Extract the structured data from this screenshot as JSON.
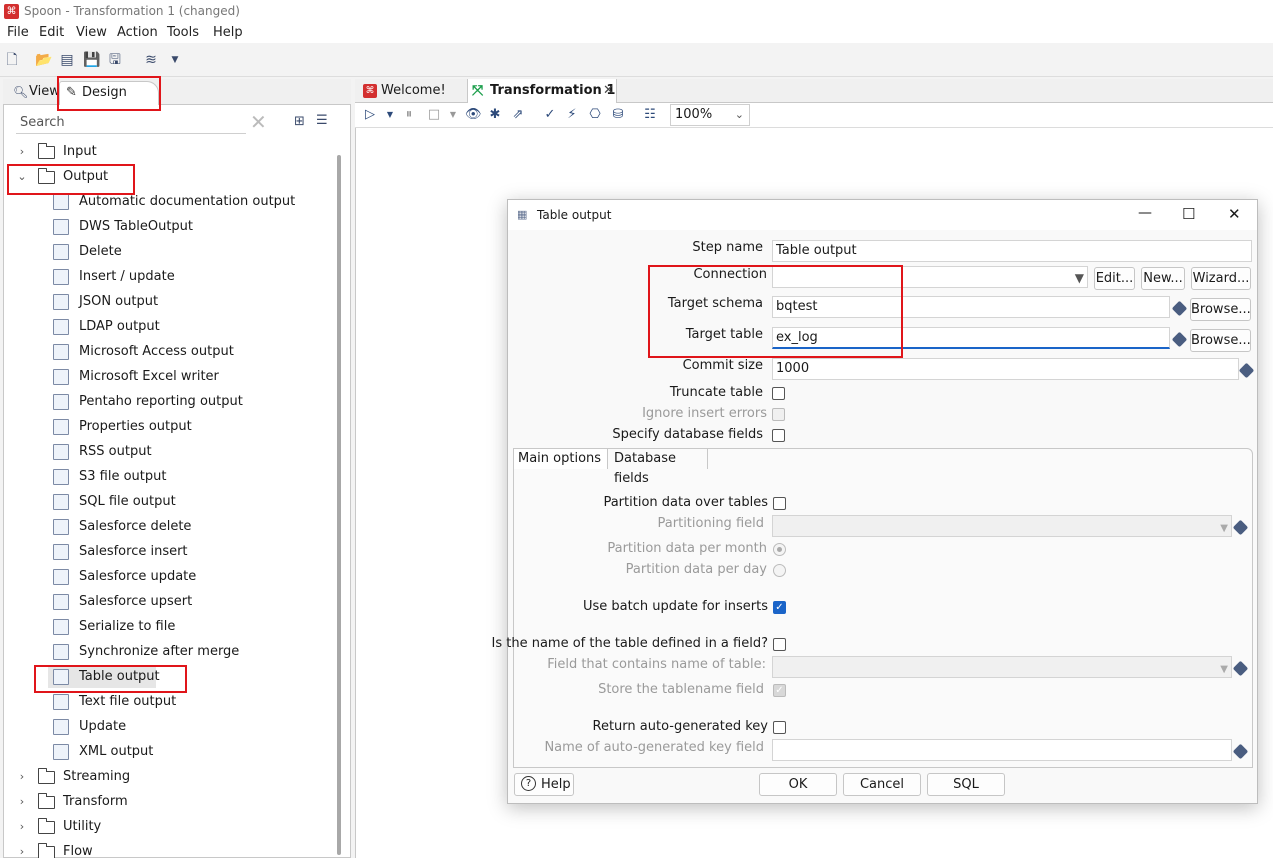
{
  "window": {
    "title": "Spoon - Transformation 1 (changed)"
  },
  "menu": [
    "File",
    "Edit",
    "View",
    "Action",
    "Tools",
    "Help"
  ],
  "left_panel": {
    "tabs": [
      "View",
      "Design"
    ],
    "search_placeholder": "Search",
    "folders_top": [
      "Input",
      "Output"
    ],
    "output_steps": [
      "Automatic documentation output",
      "DWS TableOutput",
      "Delete",
      "Insert / update",
      "JSON output",
      "LDAP output",
      "Microsoft Access output",
      "Microsoft Excel writer",
      "Pentaho reporting output",
      "Properties output",
      "RSS output",
      "S3 file output",
      "SQL file output",
      "Salesforce delete",
      "Salesforce insert",
      "Salesforce update",
      "Salesforce upsert",
      "Serialize to file",
      "Synchronize after merge",
      "Table output",
      "Text file output",
      "Update",
      "XML output"
    ],
    "folders_bottom": [
      "Streaming",
      "Transform",
      "Utility",
      "Flow"
    ]
  },
  "workspace": {
    "tabs": [
      "Welcome!",
      "Transformation 1"
    ],
    "zoom": "100%"
  },
  "dialog": {
    "title": "Table output",
    "step_name_label": "Step name",
    "step_name_value": "Table output",
    "connection_label": "Connection",
    "connection_value": "",
    "edit_btn": "Edit...",
    "new_btn": "New...",
    "wizard_btn": "Wizard...",
    "target_schema_label": "Target schema",
    "target_schema_value": "bqtest",
    "browse_btn": "Browse...",
    "target_table_label": "Target table",
    "target_table_value": "ex_log",
    "commit_size_label": "Commit size",
    "commit_size_value": "1000",
    "truncate_label": "Truncate table",
    "ignore_errors_label": "Ignore insert errors",
    "specify_fields_label": "Specify database fields",
    "tabs": [
      "Main options",
      "Database fields"
    ],
    "partition_label": "Partition data over tables",
    "partitioning_field_label": "Partitioning field",
    "per_month_label": "Partition data per month",
    "per_day_label": "Partition data per day",
    "batch_update_label": "Use batch update for inserts",
    "table_in_field_label": "Is the name of the table defined in a field?",
    "field_table_name_label": "Field that contains name of table:",
    "store_tablename_label": "Store the tablename field",
    "return_key_label": "Return auto-generated key",
    "key_field_label": "Name of auto-generated key field",
    "help_btn": "Help",
    "ok_btn": "OK",
    "cancel_btn": "Cancel",
    "sql_btn": "SQL"
  }
}
